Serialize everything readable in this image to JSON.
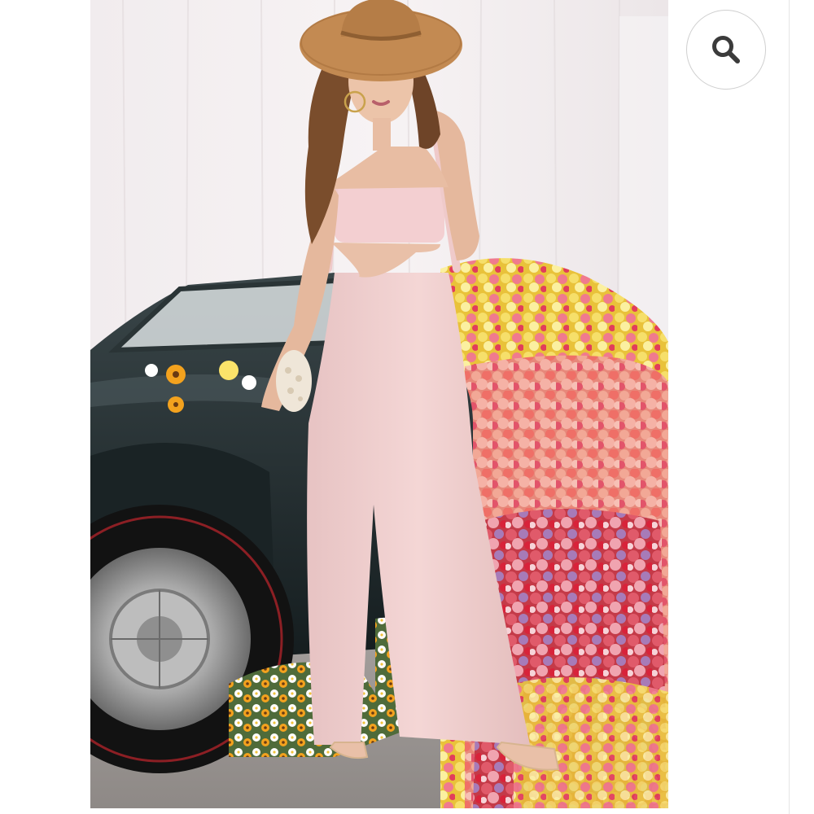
{
  "listing": {
    "photo": {
      "subject": "product-photo"
    },
    "zoom_control": {
      "icon": "magnifier-icon",
      "accent": "#3b3b3b"
    }
  },
  "colors": {
    "background": "#ffffff",
    "jumpsuit": "#f1cfd0",
    "car": "#1f2a2c",
    "hat": "#c38a52"
  }
}
